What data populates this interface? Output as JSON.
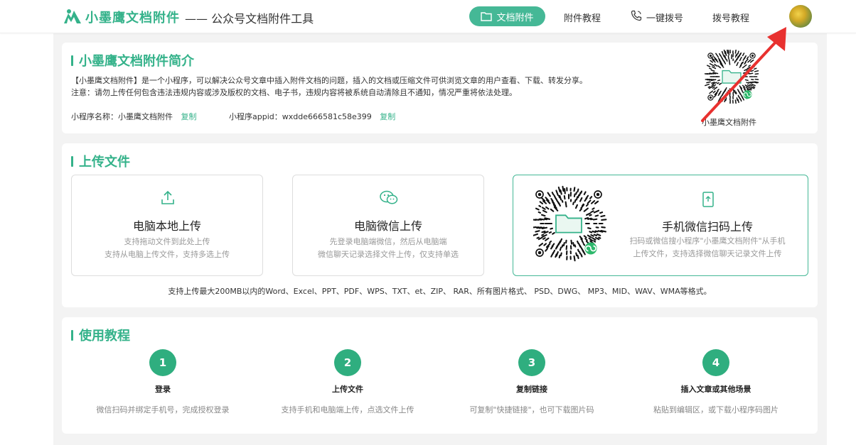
{
  "header": {
    "brand": "小墨鹰文档附件",
    "subtitle": "—— 公众号文档附件工具",
    "nav": [
      {
        "label": "文档附件",
        "active": true,
        "icon": "folder-icon"
      },
      {
        "label": "附件教程"
      },
      {
        "label": "一键拨号",
        "icon": "phone-icon"
      },
      {
        "label": "拨号教程"
      }
    ],
    "avatar_icon": "user-avatar"
  },
  "intro": {
    "title": "小墨鹰文档附件简介",
    "line1": "【小墨鹰文档附件】是一个小程序，可以解决公众号文章中插入附件文档的问题，插入的文档或压缩文件可供浏览文章的用户查看、下载、转发分享。",
    "line2": "注意：请勿上传任何包含违法违规内容或涉及版权的文档、电子书，违规内容将被系统自动清除且不通知，情况严重将依法处理。",
    "mini_name_label": "小程序名称：小墨鹰文档附件",
    "mini_appid_label": "小程序appid：wxdde666581c58e399",
    "copy_label": "复制",
    "qr_label": "小墨鹰文档附件"
  },
  "upload": {
    "title": "上传文件",
    "boxes": [
      {
        "title": "电脑本地上传",
        "desc1": "支持拖动文件到此处上传",
        "desc2": "支持从电脑上传文件，支持多选上传",
        "icon": "upload-icon"
      },
      {
        "title": "电脑微信上传",
        "desc1": "先登录电脑端微信，然后从电脑端",
        "desc2": "微信聊天记录选择文件上传，仅支持单选",
        "icon": "wechat-icon"
      },
      {
        "title": "手机微信扫码上传",
        "desc1": "扫码或微信搜小程序\"小墨鹰文档附件\"从手机",
        "desc2": "上传文件，支持选择微信聊天记录文件上传",
        "icon": "mobile-icon"
      }
    ],
    "formats": "支持上传最大200MB以内的Word、Excel、PPT、PDF、WPS、TXT、et、ZIP、 RAR、所有图片格式、 PSD、DWG、 MP3、MID、WAV、WMA等格式。"
  },
  "tutorial": {
    "title": "使用教程",
    "steps": [
      {
        "num": "1",
        "title": "登录",
        "desc": "微信扫码并绑定手机号，完成授权登录"
      },
      {
        "num": "2",
        "title": "上传文件",
        "desc": "支持手机和电脑端上传，点选文件上传"
      },
      {
        "num": "3",
        "title": "复制链接",
        "desc": "可复制\"快捷链接\"，也可下载图片码"
      },
      {
        "num": "4",
        "title": "插入文章或其他场景",
        "desc": "粘贴到编辑区，或下载小程序码图片"
      }
    ]
  },
  "colors": {
    "accent": "#34b28a",
    "nav_active": "#45b896",
    "annotation_arrow": "#e8312f"
  }
}
